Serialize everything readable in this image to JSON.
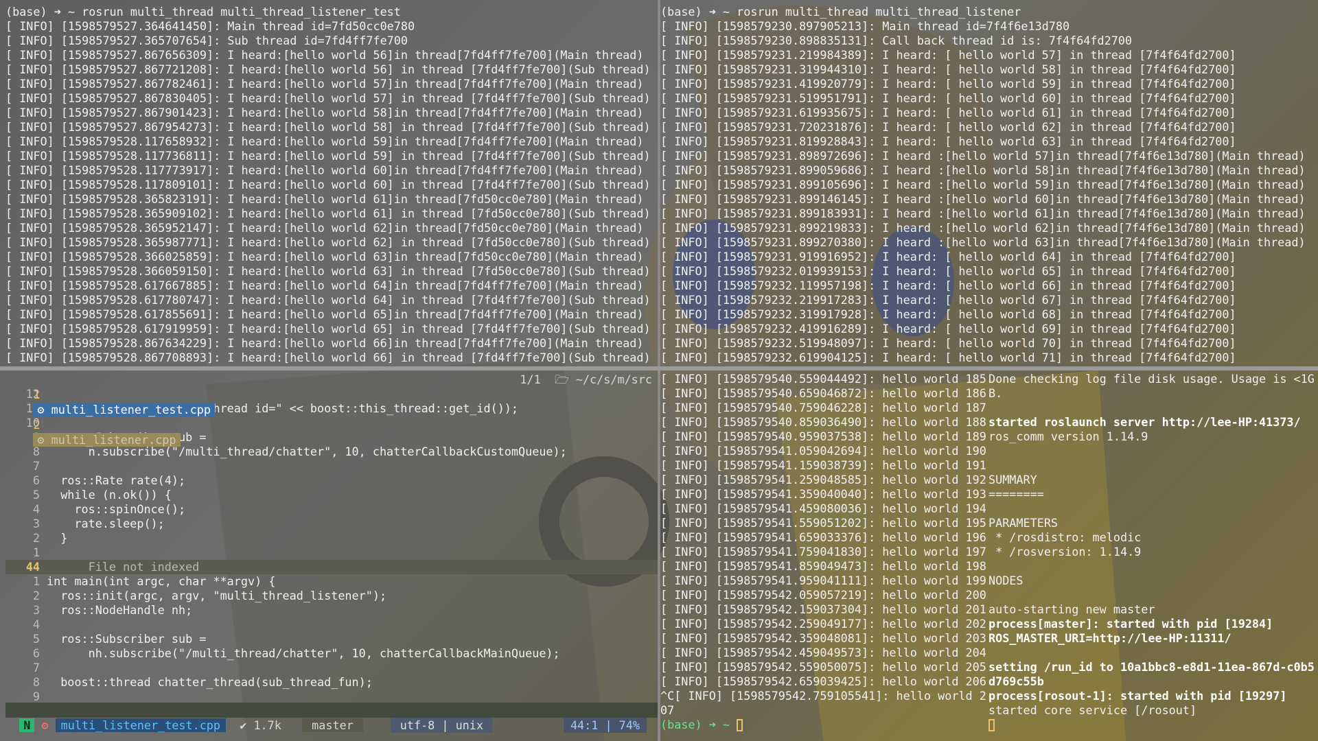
{
  "top_left": {
    "lines": [
      "(base) ➜ ~ rosrun multi_thread multi_thread_listener_test",
      "[ INFO] [1598579527.364641450]: Main thread id=7fd50cc0e780",
      "[ INFO] [1598579527.365707654]: Sub thread id=7fd4ff7fe700",
      "[ INFO] [1598579527.867656309]: I heard:[hello world 56]in thread[7fd4ff7fe700](Main thread)",
      "[ INFO] [1598579527.867721208]: I heard:[hello world 56] in thread [7fd4ff7fe700](Sub thread)",
      "[ INFO] [1598579527.867782461]: I heard:[hello world 57]in thread[7fd4ff7fe700](Main thread)",
      "[ INFO] [1598579527.867830405]: I heard:[hello world 57] in thread [7fd4ff7fe700](Sub thread)",
      "[ INFO] [1598579527.867901423]: I heard:[hello world 58]in thread[7fd4ff7fe700](Main thread)",
      "[ INFO] [1598579527.867954273]: I heard:[hello world 58] in thread [7fd4ff7fe700](Sub thread)",
      "[ INFO] [1598579528.117658932]: I heard:[hello world 59]in thread[7fd4ff7fe700](Main thread)",
      "[ INFO] [1598579528.117736811]: I heard:[hello world 59] in thread [7fd4ff7fe700](Sub thread)",
      "[ INFO] [1598579528.117773917]: I heard:[hello world 60]in thread[7fd4ff7fe700](Main thread)",
      "[ INFO] [1598579528.117809101]: I heard:[hello world 60] in thread [7fd4ff7fe700](Sub thread)",
      "[ INFO] [1598579528.365823191]: I heard:[hello world 61]in thread[7fd50cc0e780](Main thread)",
      "[ INFO] [1598579528.365909102]: I heard:[hello world 61] in thread [7fd50cc0e780](Sub thread)",
      "[ INFO] [1598579528.365952147]: I heard:[hello world 62]in thread[7fd50cc0e780](Main thread)",
      "[ INFO] [1598579528.365987771]: I heard:[hello world 62] in thread [7fd50cc0e780](Sub thread)",
      "[ INFO] [1598579528.366025859]: I heard:[hello world 63]in thread[7fd50cc0e780](Main thread)",
      "[ INFO] [1598579528.366059150]: I heard:[hello world 63] in thread [7fd50cc0e780](Sub thread)",
      "[ INFO] [1598579528.617667885]: I heard:[hello world 64]in thread[7fd4ff7fe700](Main thread)",
      "[ INFO] [1598579528.617780747]: I heard:[hello world 64] in thread [7fd4ff7fe700](Sub thread)",
      "[ INFO] [1598579528.617855691]: I heard:[hello world 65]in thread[7fd4ff7fe700](Main thread)",
      "[ INFO] [1598579528.617919959]: I heard:[hello world 65] in thread [7fd4ff7fe700](Sub thread)",
      "[ INFO] [1598579528.867634229]: I heard:[hello world 66]in thread[7fd4ff7fe700](Main thread)",
      "[ INFO] [1598579528.867708893]: I heard:[hello world 66] in thread [7fd4ff7fe700](Sub thread)"
    ]
  },
  "top_right": {
    "lines": [
      "(base) ➜ ~ rosrun multi_thread multi_thread_listener",
      "[ INFO] [1598579230.897905213]: Main thread id=7f4f6e13d780",
      "[ INFO] [1598579230.898835131]: Call back thread id is: 7f4f64fd2700",
      "[ INFO] [1598579231.219984389]: I heard: [ hello world 57] in thread [7f4f64fd2700]",
      "[ INFO] [1598579231.319944310]: I heard: [ hello world 58] in thread [7f4f64fd2700]",
      "[ INFO] [1598579231.419920779]: I heard: [ hello world 59] in thread [7f4f64fd2700]",
      "[ INFO] [1598579231.519951791]: I heard: [ hello world 60] in thread [7f4f64fd2700]",
      "[ INFO] [1598579231.619935675]: I heard: [ hello world 61] in thread [7f4f64fd2700]",
      "[ INFO] [1598579231.720231876]: I heard: [ hello world 62] in thread [7f4f64fd2700]",
      "[ INFO] [1598579231.819928843]: I heard: [ hello world 63] in thread [7f4f64fd2700]",
      "[ INFO] [1598579231.898972696]: I heard :[hello world 57]in thread[7f4f6e13d780](Main thread)",
      "[ INFO] [1598579231.899059686]: I heard :[hello world 58]in thread[7f4f6e13d780](Main thread)",
      "[ INFO] [1598579231.899105696]: I heard :[hello world 59]in thread[7f4f6e13d780](Main thread)",
      "[ INFO] [1598579231.899146145]: I heard :[hello world 60]in thread[7f4f6e13d780](Main thread)",
      "[ INFO] [1598579231.899183931]: I heard :[hello world 61]in thread[7f4f6e13d780](Main thread)",
      "[ INFO] [1598579231.899219833]: I heard :[hello world 62]in thread[7f4f6e13d780](Main thread)",
      "[ INFO] [1598579231.899270380]: I heard :[hello world 63]in thread[7f4f6e13d780](Main thread)",
      "[ INFO] [1598579231.919916952]: I heard: [ hello world 64] in thread [7f4f64fd2700]",
      "[ INFO] [1598579232.019939153]: I heard: [ hello world 65] in thread [7f4f64fd2700]",
      "[ INFO] [1598579232.119957198]: I heard: [ hello world 66] in thread [7f4f64fd2700]",
      "[ INFO] [1598579232.219917283]: I heard: [ hello world 67] in thread [7f4f64fd2700]",
      "[ INFO] [1598579232.319917928]: I heard: [ hello world 68] in thread [7f4f64fd2700]",
      "[ INFO] [1598579232.419916289]: I heard: [ hello world 69] in thread [7f4f64fd2700]",
      "[ INFO] [1598579232.519948097]: I heard: [ hello world 70] in thread [7f4f64fd2700]",
      "[ INFO] [1598579232.619904125]: I heard: [ hello world 71] in thread [7f4f64fd2700]"
    ]
  },
  "vim": {
    "tab1_num": "1",
    "tab1_label": "⚙ multi_listener_test.cpp",
    "tab2_num": "2",
    "tab2_label": "⚙ multi_listener.cpp",
    "tab_right": "1/1  🗁 ~/c/s/m/src",
    "code": [
      {
        "ln": "12",
        "t": ""
      },
      {
        "ln": "11",
        "t": "  ROS_INFO_STREAM(\"Sub thread id=\" << boost::this_thread::get_id());"
      },
      {
        "ln": "10",
        "t": ""
      },
      {
        "ln": "9",
        "t": "  ros::Subscriber sub ="
      },
      {
        "ln": "8",
        "t": "      n.subscribe(\"/multi_thread/chatter\", 10, chatterCallbackCustomQueue);"
      },
      {
        "ln": "7",
        "t": ""
      },
      {
        "ln": "6",
        "t": "  ros::Rate rate(4);"
      },
      {
        "ln": "5",
        "t": "  while (n.ok()) {"
      },
      {
        "ln": "4",
        "t": "    ros::spinOnce();"
      },
      {
        "ln": "3",
        "t": "    rate.sleep();"
      },
      {
        "ln": "2",
        "t": "  }"
      },
      {
        "ln": "1",
        "t": ""
      },
      {
        "ln": "44",
        "t": "      File not indexed"
      },
      {
        "ln": "1",
        "t": "int main(int argc, char **argv) {"
      },
      {
        "ln": "2",
        "t": "  ros::init(argc, argv, \"multi_thread_listener\");"
      },
      {
        "ln": "3",
        "t": "  ros::NodeHandle nh;"
      },
      {
        "ln": "4",
        "t": ""
      },
      {
        "ln": "5",
        "t": "  ros::Subscriber sub ="
      },
      {
        "ln": "6",
        "t": "      nh.subscribe(\"/multi_thread/chatter\", 10, chatterCallbackMainQueue);"
      },
      {
        "ln": "7",
        "t": ""
      },
      {
        "ln": "8",
        "t": "  boost::thread chatter_thread(sub_thread_fun);"
      },
      {
        "ln": "9",
        "t": ""
      }
    ],
    "status": {
      "mode": "N",
      "filename": "multi_listener_test.cpp",
      "size": "✔ 1.7k",
      "branch": "master",
      "encoding": "utf-8 | unix",
      "position": "44:1 | 74%"
    }
  },
  "bottom_left": {
    "lines": [
      "[ INFO] [1598579540.559044492]: hello world 185",
      "[ INFO] [1598579540.659046872]: hello world 186",
      "[ INFO] [1598579540.759046228]: hello world 187",
      "[ INFO] [1598579540.859036490]: hello world 188",
      "[ INFO] [1598579540.959037538]: hello world 189",
      "[ INFO] [1598579541.059042694]: hello world 190",
      "[ INFO] [1598579541.159038739]: hello world 191",
      "[ INFO] [1598579541.259048585]: hello world 192",
      "[ INFO] [1598579541.359040040]: hello world 193",
      "[ INFO] [1598579541.459080036]: hello world 194",
      "[ INFO] [1598579541.559051202]: hello world 195",
      "[ INFO] [1598579541.659033376]: hello world 196",
      "[ INFO] [1598579541.759041830]: hello world 197",
      "[ INFO] [1598579541.859049473]: hello world 198",
      "[ INFO] [1598579541.959041111]: hello world 199",
      "[ INFO] [1598579542.059057219]: hello world 200",
      "[ INFO] [1598579542.159037304]: hello world 201",
      "[ INFO] [1598579542.259049177]: hello world 202",
      "[ INFO] [1598579542.359048081]: hello world 203",
      "[ INFO] [1598579542.459049573]: hello world 204",
      "[ INFO] [1598579542.559050075]: hello world 205",
      "[ INFO] [1598579542.659039425]: hello world 206",
      "^C[ INFO] [1598579542.759105541]: hello world 2",
      "07"
    ],
    "prompt": "(base) ➜ ~"
  },
  "bottom_right": {
    "lines": [
      "Done checking log file disk usage. Usage is <1G",
      "B.",
      "",
      "started roslaunch server http://lee-HP:41373/",
      "ros_comm version 1.14.9",
      "",
      "",
      "SUMMARY",
      "========",
      "",
      "PARAMETERS",
      " * /rosdistro: melodic",
      " * /rosversion: 1.14.9",
      "",
      "NODES",
      "",
      "auto-starting new master",
      "process[master]: started with pid [19284]",
      "ROS_MASTER_URI=http://lee-HP:11311/",
      "",
      "setting /run_id to 10a1bbc8-e8d1-11ea-867d-c0b5",
      "d769c55b",
      "process[rosout-1]: started with pid [19297]",
      "started core service [/rosout]"
    ]
  }
}
